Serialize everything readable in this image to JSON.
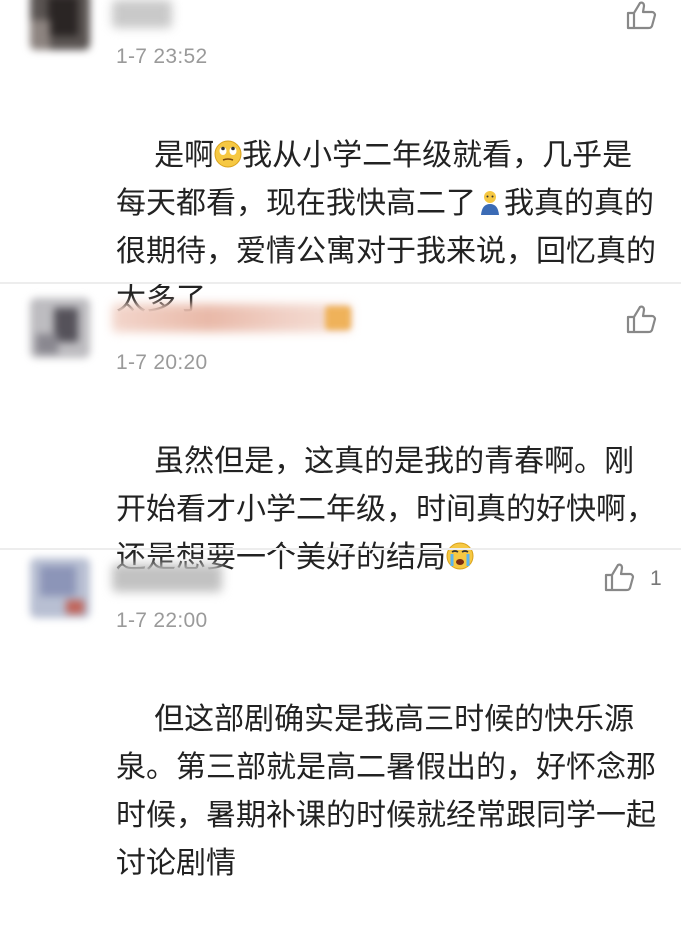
{
  "comments": [
    {
      "time": "1-7 23:52",
      "content_a": "是啊",
      "content_b": "我从小学二年级就看，几乎是每天都看，现在我快高二了",
      "content_c": "我真的真的很期待，爱情公寓对于我来说，回忆真的太多了",
      "emoji_1": "rolling-eyes-emoji",
      "emoji_2": "person-emoji",
      "like_icon": "thumbs-up-icon",
      "like_count": ""
    },
    {
      "time": "1-7 20:20",
      "content_a": "虽然但是，这真的是我的青春啊。刚开始看才小学二年级，时间真的好快啊，还是想要一个美好的结局",
      "emoji_1": "crying-face-emoji",
      "like_icon": "thumbs-up-icon",
      "like_count": ""
    },
    {
      "time": "1-7 22:00",
      "content_a": "但这部剧确实是我高三时候的快乐源泉。第三部就是高二暑假出的，好怀念那时候，暑期补课的时候就经常跟同学一起讨论剧情",
      "like_icon": "thumbs-up-icon",
      "like_count": "1"
    }
  ],
  "colors": {
    "text": "#222222",
    "time": "#9a9a9a",
    "divider": "#ededed",
    "icon": "#888888"
  }
}
